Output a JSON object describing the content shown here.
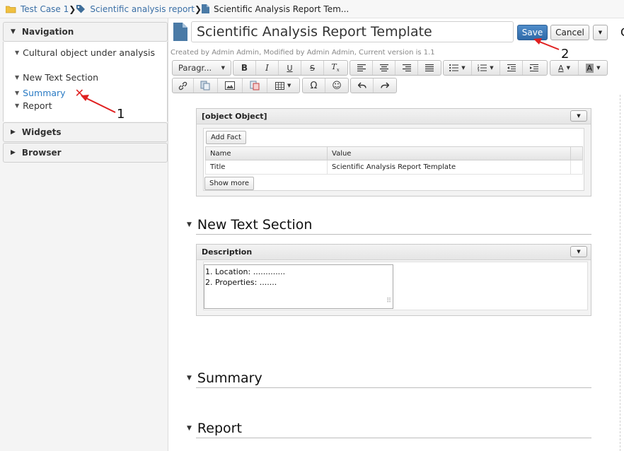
{
  "breadcrumb": {
    "items": [
      {
        "label": "Test Case 1",
        "icon": "folder-icon",
        "link": true
      },
      {
        "label": "Scientific analysis report",
        "icon": "tag-icon",
        "link": true
      },
      {
        "label": "Scientific Analysis Report Tem...",
        "icon": "document-icon",
        "link": false
      }
    ]
  },
  "sidebar": {
    "navigation_title": "Navigation",
    "items": [
      {
        "label": "Cultural object under analysis"
      },
      {
        "label": "New Text Section"
      },
      {
        "label": "Summary"
      },
      {
        "label": "Report"
      }
    ],
    "widgets_title": "Widgets",
    "browser_title": "Browser",
    "delete_glyph": "✕"
  },
  "editor": {
    "title": "Scientific Analysis Report Template",
    "save_label": "Save",
    "cancel_label": "Cancel",
    "meta": "Created by Admin Admin, Modified by Admin Admin, Current version is 1.1",
    "cutoff_char": "C"
  },
  "toolbar": {
    "paragraph_label": "Paragr..."
  },
  "fact_widget": {
    "title": "[object Object]",
    "add_fact_label": "Add Fact",
    "columns": [
      "Name",
      "Value"
    ],
    "rows": [
      {
        "name": "Title",
        "value": "Scientific Analysis Report Template"
      }
    ],
    "show_more_label": "Show more"
  },
  "sections": {
    "new_text": "New Text Section",
    "summary": "Summary",
    "report": "Report"
  },
  "description_widget": {
    "title": "Description",
    "lines": [
      "1. Location: .............",
      "2. Properties: ......."
    ]
  },
  "annotations": {
    "one": "1",
    "two": "2"
  },
  "colors": {
    "link": "#2a7bc4",
    "save_button": "#3a79bb",
    "arrow": "#e02020"
  }
}
